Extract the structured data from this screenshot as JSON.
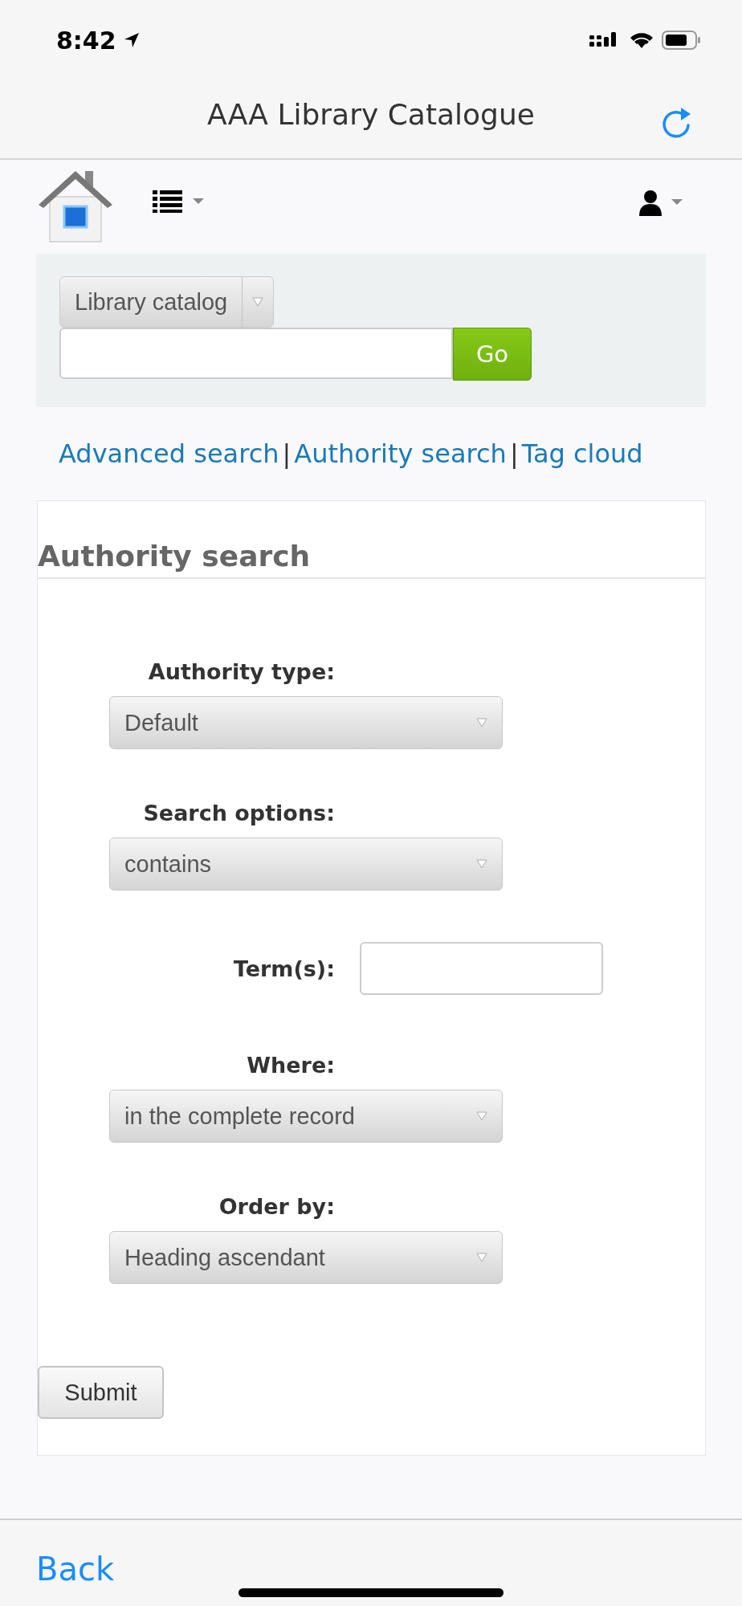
{
  "status_bar": {
    "time": "8:42"
  },
  "browser": {
    "title": "AAA Library Catalogue",
    "back": "Back"
  },
  "search": {
    "scope": "Library catalog",
    "button": "Go"
  },
  "links": [
    {
      "kind": "link",
      "label": "Advanced search"
    },
    {
      "kind": "separator",
      "label": "|"
    },
    {
      "kind": "link",
      "label": "Authority search"
    },
    {
      "kind": "separator",
      "label": "|"
    },
    {
      "kind": "link",
      "label": "Tag cloud"
    }
  ],
  "panel": {
    "title": "Authority search",
    "fields": [
      {
        "kind": "select",
        "label": "Authority type:",
        "value": "Default"
      },
      {
        "kind": "select",
        "label": "Search options:",
        "value": "contains"
      },
      {
        "kind": "text",
        "label": "Term(s):"
      },
      {
        "kind": "select",
        "label": "Where:",
        "value": "in the complete record"
      },
      {
        "kind": "select",
        "label": "Order by:",
        "value": "Heading ascendant"
      }
    ],
    "submit": "Submit"
  }
}
